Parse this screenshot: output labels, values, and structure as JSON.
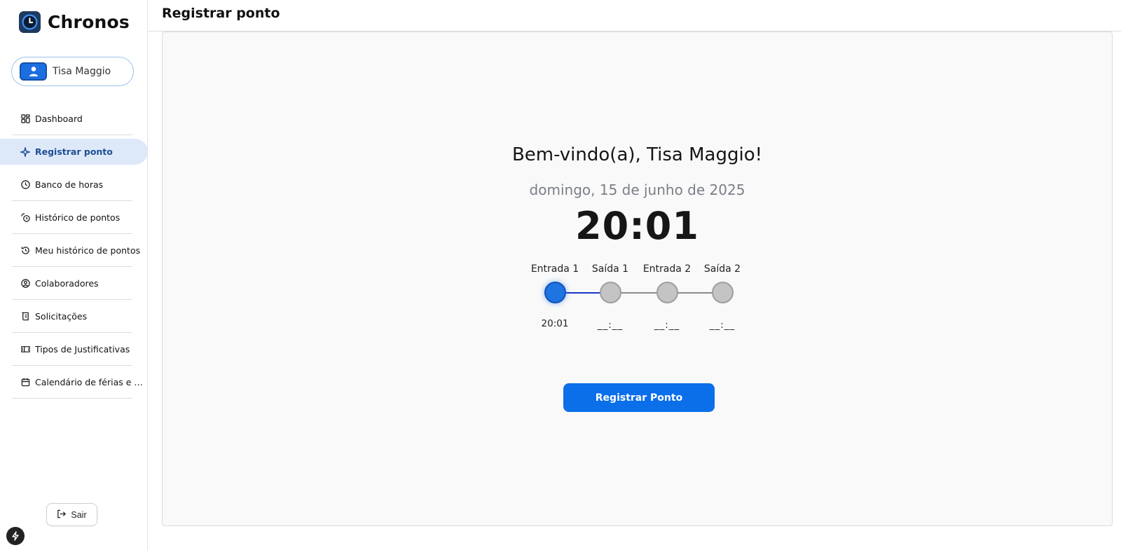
{
  "app": {
    "name": "Chronos"
  },
  "user": {
    "name": "Tisa Maggio"
  },
  "sidebar": {
    "items": [
      {
        "label": "Dashboard",
        "icon": "grid-icon",
        "active": false
      },
      {
        "label": "Registrar ponto",
        "icon": "sparkle-icon",
        "active": true
      },
      {
        "label": "Banco de horas",
        "icon": "clock-icon",
        "active": false
      },
      {
        "label": "Histórico de pontos",
        "icon": "history-fingerprint-icon",
        "active": false
      },
      {
        "label": "Meu histórico de pontos",
        "icon": "history-icon",
        "active": false
      },
      {
        "label": "Colaboradores",
        "icon": "user-circle-icon",
        "active": false
      },
      {
        "label": "Solicitações",
        "icon": "scroll-icon",
        "active": false
      },
      {
        "label": "Tipos de Justificativas",
        "icon": "ticket-icon",
        "active": false
      },
      {
        "label": "Calendário de férias e afastamentos",
        "icon": "calendar-icon",
        "active": false
      }
    ],
    "logout_label": "Sair"
  },
  "header": {
    "title": "Registrar ponto"
  },
  "main": {
    "welcome": "Bem-vindo(a), Tisa Maggio!",
    "date": "domingo, 15 de junho de 2025",
    "clock": "20:01",
    "steps": [
      {
        "label": "Entrada 1",
        "time": "20:01",
        "done": true
      },
      {
        "label": "Saída 1",
        "time": "__:__",
        "done": false
      },
      {
        "label": "Entrada 2",
        "time": "__:__",
        "done": false
      },
      {
        "label": "Saída 2",
        "time": "__:__",
        "done": false
      }
    ],
    "register_button": "Registrar Ponto"
  },
  "colors": {
    "accent": "#0b6fea",
    "active_nav_bg": "#dde9f9",
    "active_nav_text": "#1f4e93",
    "step_done": "#1e74e0",
    "step_pending": "#c4c4c4"
  }
}
